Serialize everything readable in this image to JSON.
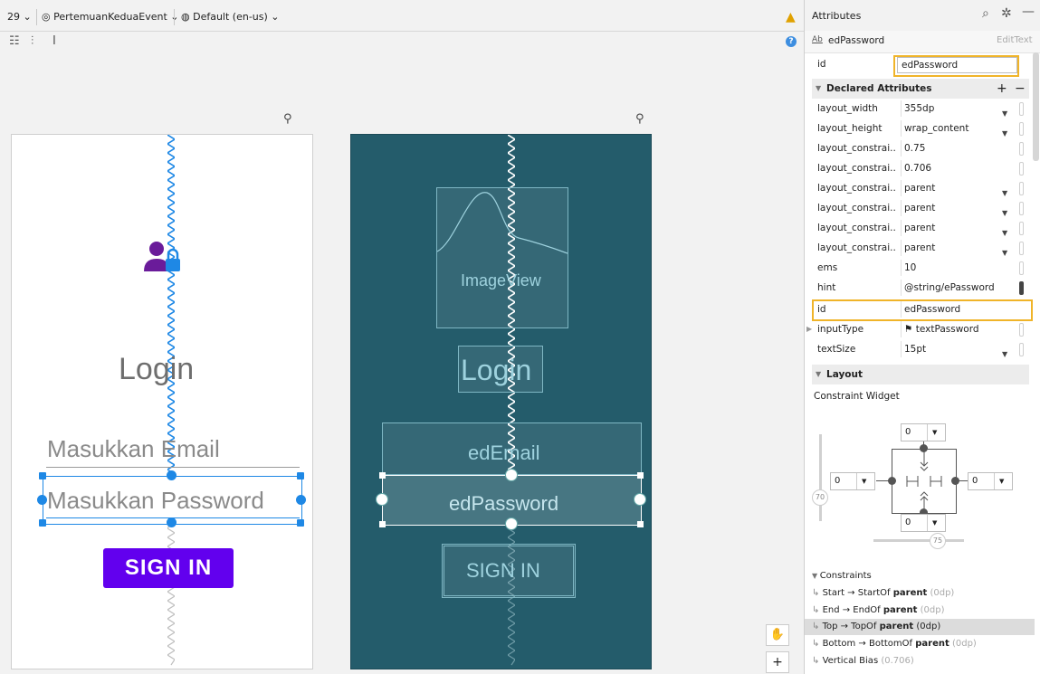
{
  "toolbar": {
    "api_level": "29",
    "theme": "PertemuanKeduaEvent",
    "locale": "Default (en-us)"
  },
  "design_screen": {
    "title_text": "Login",
    "email_hint": "Masukkan Email",
    "password_hint": "Masukkan Password",
    "button_label": "SIGN IN"
  },
  "blueprint_screen": {
    "image_label": "ImageView",
    "title_label": "Login",
    "email_label": "edEmail",
    "password_label": "edPassword",
    "button_label": "SIGN IN"
  },
  "attributes_panel": {
    "title": "Attributes",
    "component_name": "edPassword",
    "component_type": "EditText",
    "id_label": "id",
    "id_value": "edPassword",
    "declared_header": "Declared Attributes",
    "attributes": [
      {
        "key": "layout_width",
        "value": "355dp"
      },
      {
        "key": "layout_height",
        "value": "wrap_content"
      },
      {
        "key": "layout_constrai...",
        "value": "0.75"
      },
      {
        "key": "layout_constrai...",
        "value": "0.706"
      },
      {
        "key": "layout_constrai...",
        "value": "parent"
      },
      {
        "key": "layout_constrai...",
        "value": "parent"
      },
      {
        "key": "layout_constrai...",
        "value": "parent"
      },
      {
        "key": "layout_constrai...",
        "value": "parent"
      },
      {
        "key": "ems",
        "value": "10"
      },
      {
        "key": "hint",
        "value": "@string/ePassword"
      },
      {
        "key": "id",
        "value": "edPassword"
      },
      {
        "key": "inputType",
        "value": "textPassword"
      },
      {
        "key": "textSize",
        "value": "15pt"
      }
    ],
    "layout_header": "Layout",
    "constraint_widget_label": "Constraint Widget",
    "margin_top": "0",
    "margin_left": "0",
    "margin_right": "0",
    "margin_bottom": "0",
    "vertical_bias": "70",
    "horizontal_bias": "75",
    "constraints_header": "Constraints",
    "constraints": [
      {
        "label": "Start → StartOf",
        "target": "parent",
        "extra": "(0dp)"
      },
      {
        "label": "End → EndOf",
        "target": "parent",
        "extra": "(0dp)"
      },
      {
        "label": "Top → TopOf",
        "target": "parent",
        "extra": "(0dp)"
      },
      {
        "label": "Bottom → BottomOf",
        "target": "parent",
        "extra": "(0dp)"
      },
      {
        "label": "Vertical Bias",
        "target": "",
        "extra": "(0.706)"
      }
    ]
  }
}
